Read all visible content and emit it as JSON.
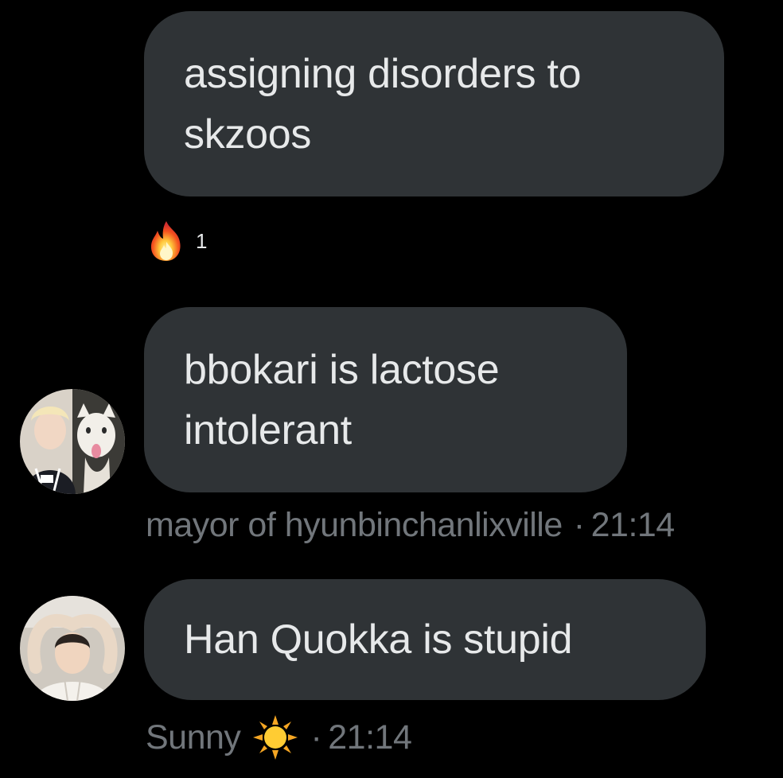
{
  "messages": [
    {
      "text_line1": "assigning disorders to",
      "text_line2": "skzoos",
      "reaction": {
        "icon": "fire-emoji",
        "count": "1"
      }
    },
    {
      "text_line1": "bbokari is lactose",
      "text_line2": "intolerant",
      "sender": "mayor of hyunbinchanlixville",
      "separator": "·",
      "time": "21:14",
      "avatar": "avatar-person-with-cat"
    },
    {
      "text_line1": "Han Quokka is stupid",
      "sender": "Sunny",
      "sender_emoji": "sun-emoji",
      "separator": "·",
      "time": "21:14",
      "avatar": "avatar-person-heart-hands"
    }
  ],
  "colors": {
    "background": "#000000",
    "bubble": "#2f3336",
    "text": "#e7e9ea",
    "meta": "#71767b"
  }
}
